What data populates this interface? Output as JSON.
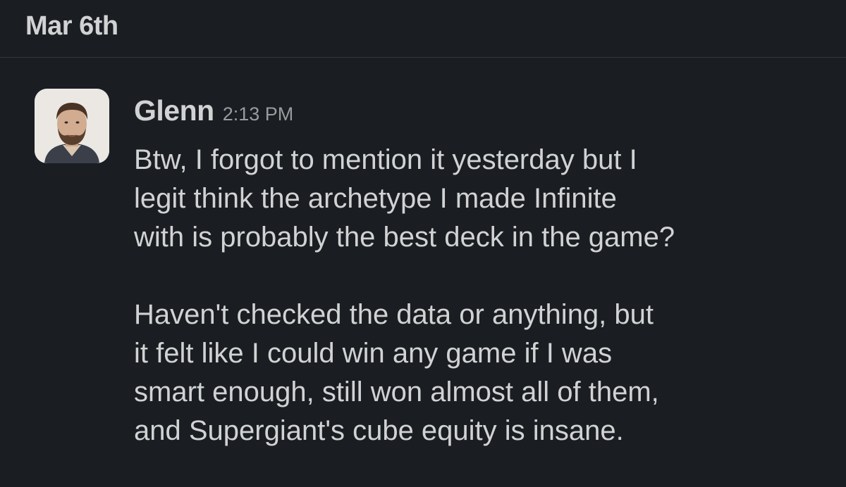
{
  "date_divider": {
    "label": "Mar 6th"
  },
  "message": {
    "sender": "Glenn",
    "timestamp": "2:13 PM",
    "paragraph1_lines": [
      "Btw, I forgot to mention it yesterday but I",
      "legit think the archetype I made Infinite",
      "with is probably the best deck in the game?"
    ],
    "paragraph2_lines": [
      "Haven't checked the data or anything, but",
      "it felt like I could win any game if I was",
      "smart enough, still won almost all of them,",
      "and Supergiant's cube equity is insane."
    ]
  },
  "colors": {
    "background": "#1a1d21",
    "text": "#d1d2d3",
    "timestamp": "#9a9b9d",
    "divider": "#34373b"
  }
}
